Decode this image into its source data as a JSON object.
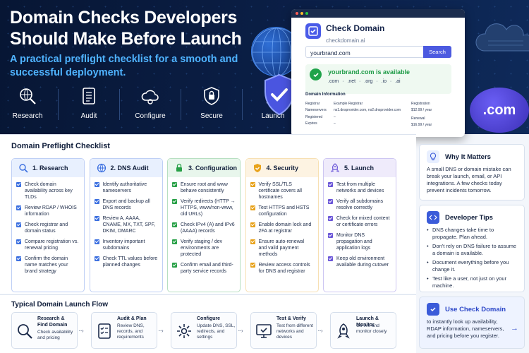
{
  "hero": {
    "title": "Domain Checks Developers Should Make Before Launch",
    "subtitle": "A practical preflight checklist for a smooth and successful deployment.",
    "icons": [
      {
        "label": "Research",
        "icon": "magnifier-globe-icon"
      },
      {
        "label": "Audit",
        "icon": "document-list-icon"
      },
      {
        "label": "Configure",
        "icon": "cloud-gear-icon"
      },
      {
        "label": "Secure",
        "icon": "lock-shield-icon"
      },
      {
        "label": "Launch",
        "icon": "rocket-icon"
      }
    ],
    "badge_text": ".com"
  },
  "browser": {
    "brand_title": "Check Domain",
    "brand_sub": "checkdomain.ai",
    "search_value": "yourbrand.com",
    "search_button": "Search",
    "available_text": "yourbrand.com is available",
    "tlds": ".com  ·  .net  ·  .org  ·  .io  ·  .ai",
    "info_title": "Domain Information",
    "rows": [
      {
        "k": "Registrar",
        "v": "Example Registrar"
      },
      {
        "k": "Nameservers",
        "v": "ns1.dnsprovider.com, ns2.dnsprovider.com"
      },
      {
        "k": "Registered",
        "v": "–"
      },
      {
        "k": "Expires",
        "v": "–"
      }
    ],
    "registration_label": "Registration",
    "registration_price": "$12.99 / year",
    "renewal_label": "Renewal",
    "renewal_price": "$16.99 / year"
  },
  "checklist": {
    "title": "Domain Preflight Checklist",
    "columns": [
      {
        "title": "1. Research",
        "color": "#3b6fe0",
        "bg": "#e8f0fe",
        "items": [
          "Check domain availability across key TLDs",
          "Review RDAP / WHOIS information",
          "Check registrar and domain status",
          "Compare registration vs. renewal pricing",
          "Confirm the domain name matches your brand strategy"
        ]
      },
      {
        "title": "2. DNS Audit",
        "color": "#3b6fe0",
        "bg": "#e8f0fe",
        "items": [
          "Identify authoritative nameservers",
          "Export and backup all DNS records",
          "Review A, AAAA, CNAME, MX, TXT, SPF, DKIM, DMARC",
          "Inventory important subdomains",
          "Check TTL values before planned changes"
        ]
      },
      {
        "title": "3. Configuration",
        "color": "#27a046",
        "bg": "#e8f6ec",
        "items": [
          "Ensure root and www behave consistently",
          "Verify redirects (HTTP → HTTPS, www/non-www, old URLs)",
          "Check IPv4 (A) and IPv6 (AAAA) records",
          "Verify staging / dev environments are protected",
          "Confirm email and third-party service records"
        ]
      },
      {
        "title": "4. Security",
        "color": "#e8a21a",
        "bg": "#fdf3e2",
        "items": [
          "Verify SSL/TLS certificate covers all hostnames",
          "Test HTTPS and HSTS configuration",
          "Enable domain lock and 2FA at registrar",
          "Ensure auto-renewal and valid payment methods",
          "Review access controls for DNS and registrar"
        ]
      },
      {
        "title": "5. Launch",
        "color": "#6a55d8",
        "bg": "#efebfb",
        "items": [
          "Test from multiple networks and devices",
          "Verify all subdomains resolve correctly",
          "Check for mixed content or certificate errors",
          "Monitor DNS propagation and application logs",
          "Keep old environment available during cutover"
        ]
      }
    ]
  },
  "flow": {
    "title": "Typical Domain Launch Flow",
    "steps": [
      {
        "title": "Research & Find Domain",
        "desc": "Check availability and pricing",
        "icon": "magnifier-icon"
      },
      {
        "title": "Audit & Plan",
        "desc": "Review DNS, records, and requirements",
        "icon": "checklist-icon"
      },
      {
        "title": "Configure",
        "desc": "Update DNS, SSL, redirects, and settings",
        "icon": "gear-icon"
      },
      {
        "title": "Test & Verify",
        "desc": "Test from different networks and devices",
        "icon": "monitor-check-icon"
      },
      {
        "title": "Launch & Monitor",
        "desc": "Go live and monitor closely",
        "icon": "rocket-icon"
      }
    ]
  },
  "sidebar": {
    "why_title": "Why It Matters",
    "why_text": "A small DNS or domain mistake can break your launch, email, or API integrations. A few checks today prevent incidents tomorrow.",
    "tips_title": "Developer Tips",
    "tips": [
      "DNS changes take time to propagate. Plan ahead.",
      "Don't rely on DNS failure to assume a domain is available.",
      "Document everything before you change it.",
      "Test like a user, not just on your machine."
    ],
    "cta_title": "Use Check Domain",
    "cta_text": "to instantly look up availability, RDAP information, nameservers, and pricing before you register."
  }
}
